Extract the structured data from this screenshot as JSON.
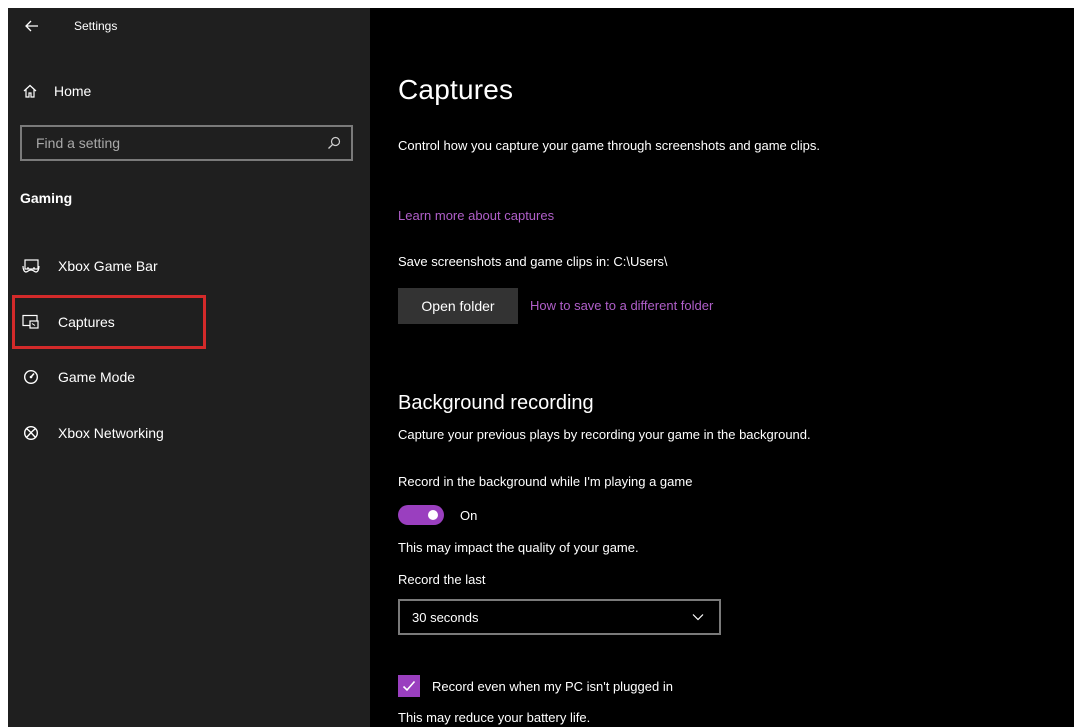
{
  "window": {
    "title": "Settings"
  },
  "sidebar": {
    "home_label": "Home",
    "search_placeholder": "Find a setting",
    "section_heading": "Gaming",
    "items": [
      {
        "label": "Xbox Game Bar",
        "icon": "game-bar-icon"
      },
      {
        "label": "Captures",
        "icon": "captures-icon",
        "highlighted": true
      },
      {
        "label": "Game Mode",
        "icon": "game-mode-icon"
      },
      {
        "label": "Xbox Networking",
        "icon": "xbox-icon"
      }
    ]
  },
  "main": {
    "title": "Captures",
    "description": "Control how you capture your game through screenshots and game clips.",
    "learn_more_link": "Learn more about captures",
    "save_path_text": "Save screenshots and game clips in: C:\\Users\\",
    "open_folder_button": "Open folder",
    "save_location_link": "How to save to a different folder",
    "background_recording": {
      "title": "Background recording",
      "description": "Capture your previous plays by recording your game in the background.",
      "toggle_label": "Record in the background while I'm playing a game",
      "toggle_state": "On",
      "toggle_on": true,
      "impact_note": "This may impact the quality of your game.",
      "record_last_label": "Record the last",
      "record_last_value": "30 seconds",
      "checkbox_label": "Record even when my PC isn't plugged in",
      "checkbox_checked": true,
      "battery_note": "This may reduce your battery life."
    }
  },
  "colors": {
    "accent": "#9a3fbf",
    "link": "#b05fc9",
    "sidebar_bg": "#1f1f1f",
    "main_bg": "#000000",
    "highlight_border": "#d32a2a"
  }
}
